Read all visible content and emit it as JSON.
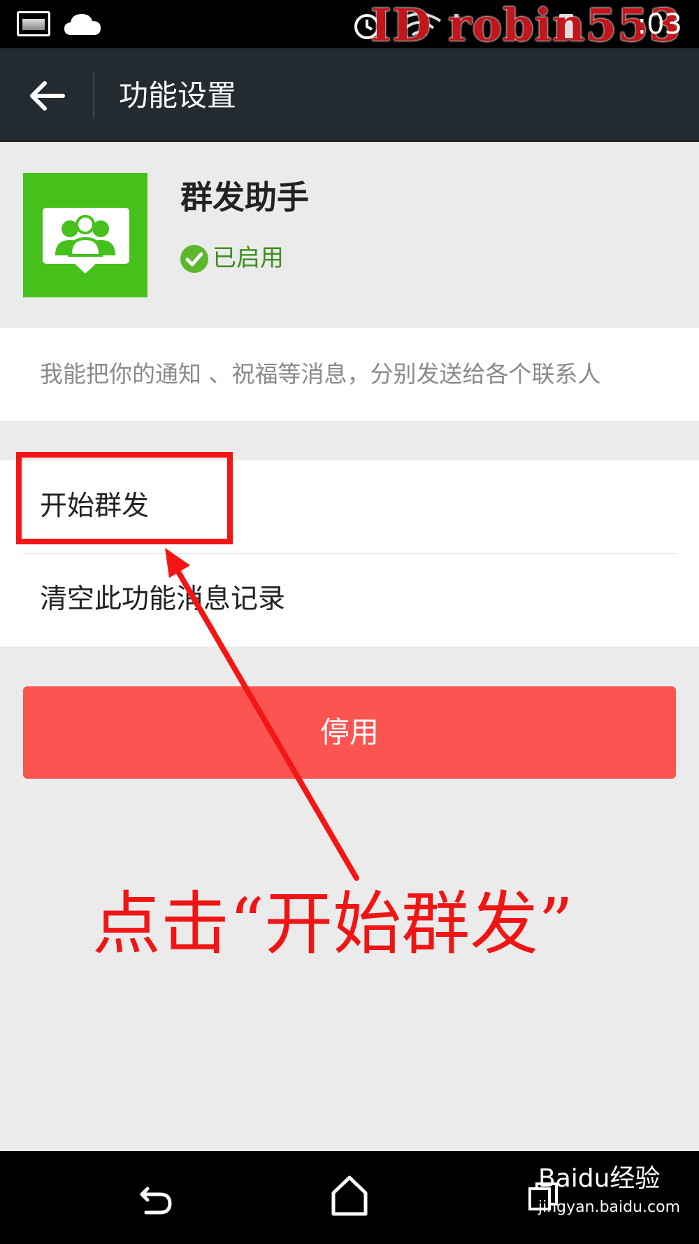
{
  "status_bar": {
    "time": ":03",
    "watermark": "ID robin553",
    "icons": [
      "image-icon",
      "cloud-icon",
      "alarm-icon",
      "wifi-icon",
      "signal-icon",
      "battery-icon"
    ]
  },
  "header": {
    "title": "功能设置",
    "back_icon": "arrow-left-icon"
  },
  "plugin": {
    "name": "群发助手",
    "status": "已启用",
    "icon": "group-chat-icon",
    "icon_color": "#46c11b"
  },
  "description": "我能把你的通知 、祝福等消息，分别发送给各个联系人",
  "list": {
    "items": [
      {
        "label": "开始群发"
      },
      {
        "label": "清空此功能消息记录"
      }
    ]
  },
  "disable_button": {
    "label": "停用",
    "color": "#fc5451"
  },
  "annotation": {
    "text": "点击“开始群发”",
    "color": "#f01515"
  },
  "nav_bar": {
    "baidu_logo": "Baidu经验",
    "baidu_url": "jingyan.baidu.com",
    "icons": [
      "back-icon",
      "home-icon",
      "recent-apps-icon"
    ]
  }
}
